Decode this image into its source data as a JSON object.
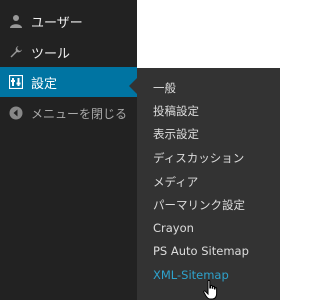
{
  "sidebar": {
    "items": [
      {
        "label": "ユーザー",
        "icon": "user-icon"
      },
      {
        "label": "ツール",
        "icon": "wrench-icon"
      },
      {
        "label": "設定",
        "icon": "settings-icon"
      },
      {
        "label": "メニューを閉じる",
        "icon": "collapse-icon"
      }
    ]
  },
  "submenu": {
    "items": [
      "一般",
      "投稿設定",
      "表示設定",
      "ディスカッション",
      "メディア",
      "パーマリンク設定",
      "Crayon",
      "PS Auto Sitemap",
      "XML-Sitemap"
    ]
  },
  "colors": {
    "active_bg": "#0074a2",
    "current_link": "#2ea2cc",
    "sidebar_bg": "#222222",
    "submenu_bg": "#333333"
  }
}
